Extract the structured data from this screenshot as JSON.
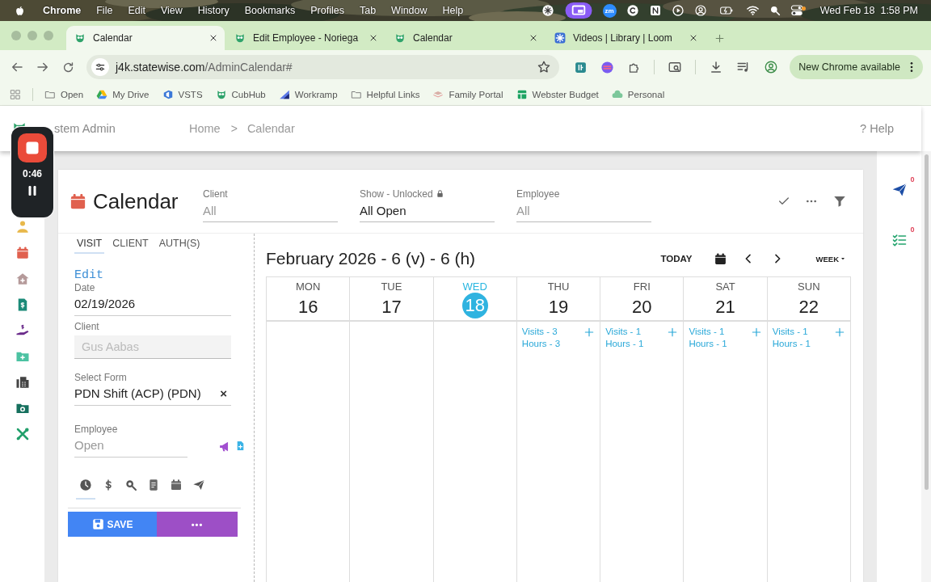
{
  "menu_bar": {
    "app": "Chrome",
    "menus": [
      "File",
      "Edit",
      "View",
      "History",
      "Bookmarks",
      "Profiles",
      "Tab",
      "Window",
      "Help"
    ],
    "zoom_badge": "zm",
    "clock": "Wed Feb 18  1:58 PM"
  },
  "browser": {
    "tabs": [
      {
        "title": "Calendar",
        "selected": true,
        "kind": "owl"
      },
      {
        "title": "Edit Employee - Noriega",
        "selected": false,
        "kind": "owl"
      },
      {
        "title": "Calendar",
        "selected": false,
        "kind": "owl"
      },
      {
        "title": "Videos | Library | Loom",
        "selected": false,
        "kind": "loom"
      }
    ],
    "address": {
      "host": "j4k.statewise.com",
      "path": "/AdminCalendar#"
    },
    "update_button": "New Chrome available",
    "bookmarks": [
      {
        "label": "Open",
        "kind": "folder"
      },
      {
        "label": "My Drive",
        "kind": "drive"
      },
      {
        "label": "VSTS",
        "kind": "vsts"
      },
      {
        "label": "CubHub",
        "kind": "owl"
      },
      {
        "label": "Workramp",
        "kind": "ramp"
      },
      {
        "label": "Helpful Links",
        "kind": "folder"
      },
      {
        "label": "Family Portal",
        "kind": "stack"
      },
      {
        "label": "Webster Budget",
        "kind": "sheet"
      },
      {
        "label": "Personal",
        "kind": "cloud"
      }
    ]
  },
  "app_header": {
    "title": "stem Admin",
    "breadcrumbs": [
      "Home",
      "Calendar"
    ],
    "separator": ">",
    "help": "? Help"
  },
  "recorder": {
    "time": "0:46"
  },
  "calendar": {
    "title": "Calendar",
    "filters": [
      {
        "label": "Client",
        "placeholder": "All",
        "locked": false
      },
      {
        "label": "Show - Unlocked",
        "value": "All Open",
        "locked": true
      },
      {
        "label": "Employee",
        "placeholder": "All",
        "locked": false
      }
    ],
    "panel": {
      "tabs": [
        {
          "label": "VISIT",
          "selected": true
        },
        {
          "label": "CLIENT",
          "selected": false
        },
        {
          "label": "AUTH(S)",
          "selected": false
        }
      ],
      "heading": "Edit",
      "fields": [
        {
          "kind": "text",
          "label": "Date",
          "value": "02/19/2026"
        },
        {
          "kind": "disabled",
          "label": "Client",
          "value": "Gus Aabas"
        },
        {
          "kind": "select",
          "label": "Select Form",
          "value": "PDN Shift (ACP) (PDN)",
          "clear": "×"
        },
        {
          "kind": "employee",
          "label": "Employee",
          "placeholder": "Open"
        }
      ],
      "icon_tabs": [
        {
          "kind": "clock",
          "selected": true
        },
        {
          "kind": "dollar",
          "selected": false
        },
        {
          "kind": "search",
          "selected": false
        },
        {
          "kind": "document",
          "selected": false
        },
        {
          "kind": "calendar",
          "selected": false
        },
        {
          "kind": "send",
          "selected": false
        }
      ],
      "save": "SAVE",
      "more": "•••"
    },
    "week": {
      "title": "February 2026 - 6 (v) - 6 (h)",
      "today_button": "TODAY",
      "view": "WEEK",
      "days": [
        {
          "name": "MON",
          "date": "16",
          "today": false
        },
        {
          "name": "TUE",
          "date": "17",
          "today": false
        },
        {
          "name": "WED",
          "date": "18",
          "today": true
        },
        {
          "name": "THU",
          "date": "19",
          "today": false,
          "visits": "Visits - 3",
          "hours": "Hours - 3"
        },
        {
          "name": "FRI",
          "date": "20",
          "today": false,
          "visits": "Visits - 1",
          "hours": "Hours - 1"
        },
        {
          "name": "SAT",
          "date": "21",
          "today": false,
          "visits": "Visits - 1",
          "hours": "Hours - 1"
        },
        {
          "name": "SUN",
          "date": "22",
          "today": false,
          "visits": "Visits - 1",
          "hours": "Hours - 1"
        }
      ]
    }
  },
  "right_rail": [
    {
      "kind": "send",
      "count": "0"
    },
    {
      "kind": "checklist",
      "count": "0"
    }
  ]
}
